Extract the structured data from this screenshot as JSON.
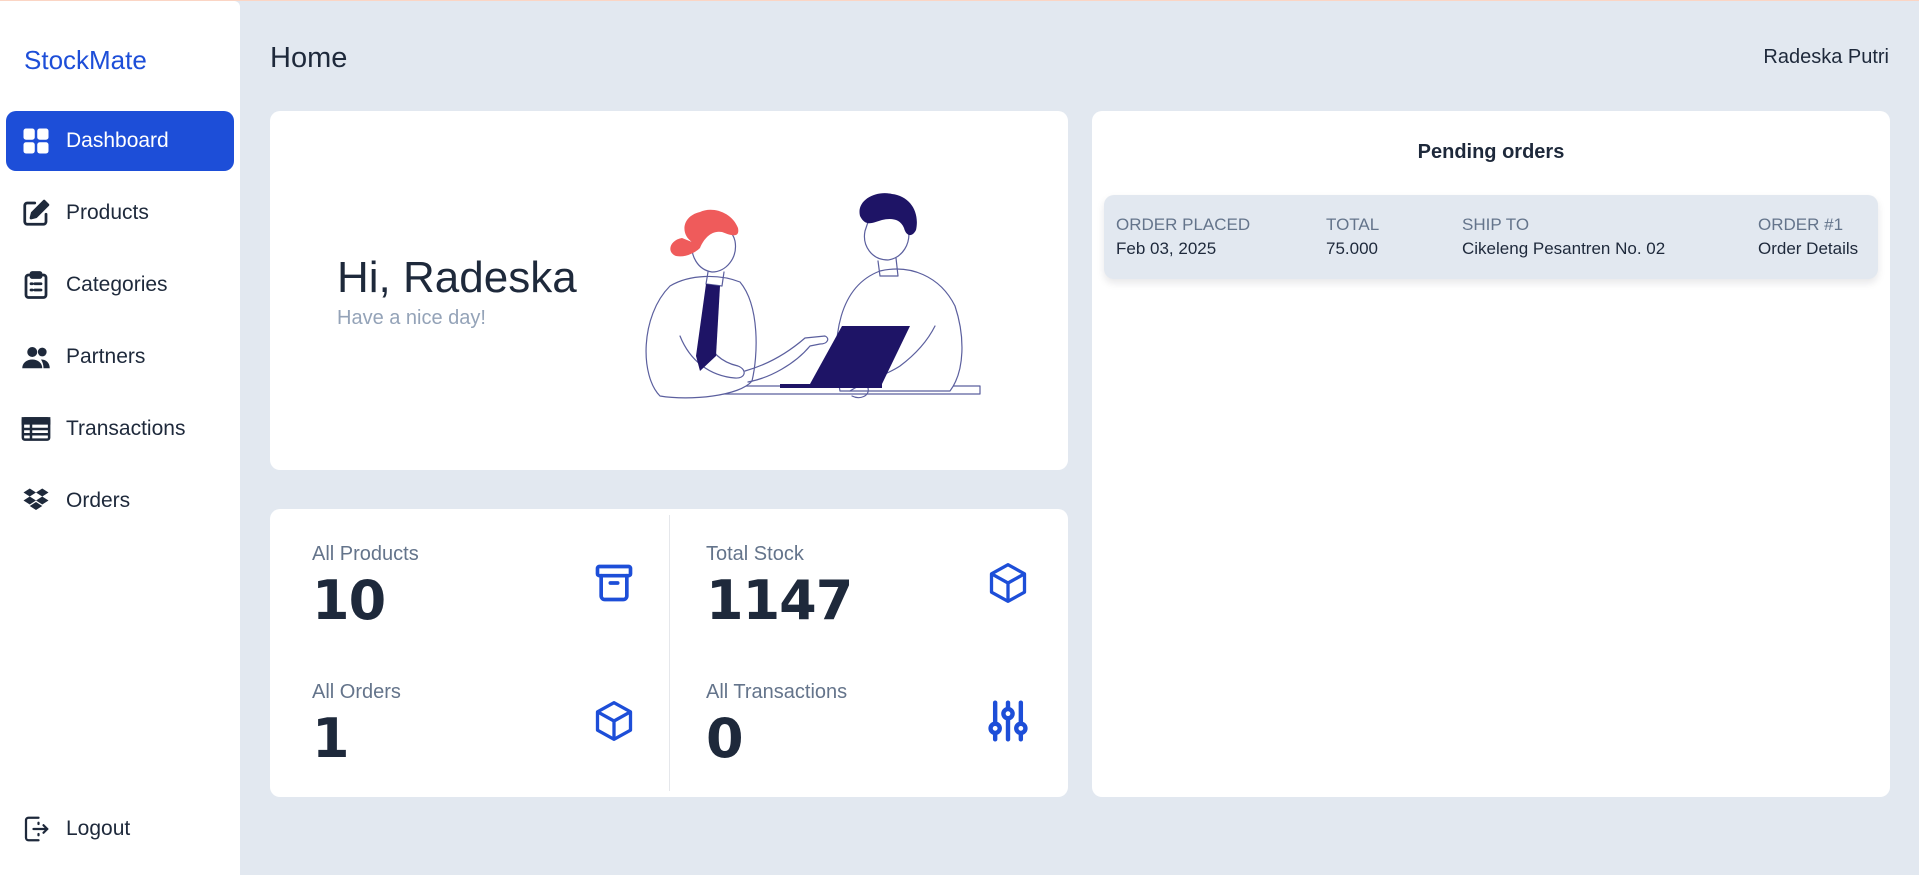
{
  "app": {
    "brand": "StockMate"
  },
  "sidebar": {
    "items": [
      {
        "label": "Dashboard",
        "icon": "dashboard-grid-icon",
        "active": true
      },
      {
        "label": "Products",
        "icon": "edit-icon"
      },
      {
        "label": "Categories",
        "icon": "clipboard-icon"
      },
      {
        "label": "Partners",
        "icon": "users-icon"
      },
      {
        "label": "Transactions",
        "icon": "table-icon"
      },
      {
        "label": "Orders",
        "icon": "dropbox-icon"
      }
    ],
    "logout_label": "Logout"
  },
  "header": {
    "title": "Home",
    "user": "Radeska Putri"
  },
  "welcome": {
    "greeting": "Hi, Radeska",
    "subtitle": "Have a nice day!"
  },
  "stats": [
    {
      "label": "All Products",
      "value": "10",
      "icon": "archive-box-icon"
    },
    {
      "label": "Total Stock",
      "value": "1147",
      "icon": "cube-icon"
    },
    {
      "label": "All Orders",
      "value": "1",
      "icon": "cube-icon"
    },
    {
      "label": "All Transactions",
      "value": "0",
      "icon": "sliders-icon"
    }
  ],
  "pending": {
    "title": "Pending orders",
    "orders": [
      {
        "placed_label": "ORDER PLACED",
        "placed": "Feb 03, 2025",
        "total_label": "TOTAL",
        "total": "75.000",
        "ship_label": "SHIP TO",
        "ship_to": "Cikeleng Pesantren No. 02",
        "order_label": "ORDER #1",
        "details": "Order Details"
      }
    ]
  },
  "colors": {
    "accent": "#1d4ed8",
    "background": "#e2e8f0",
    "illustration_navy": "#1e1466",
    "illustration_red": "#ef5b5b"
  }
}
